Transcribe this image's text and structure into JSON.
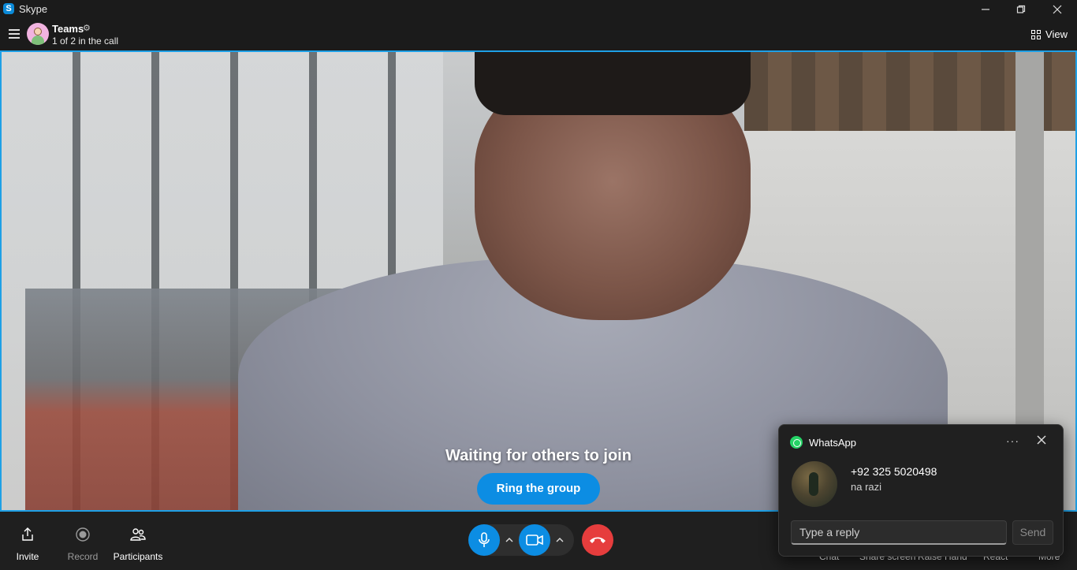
{
  "window": {
    "app_title": "Skype",
    "app_logo_letter": "S"
  },
  "header": {
    "conversation_title": "Teams",
    "subtitle": "1 of 2 in the call",
    "view_label": "View"
  },
  "call": {
    "status_text": "Waiting for others to join",
    "ring_button_label": "Ring the group"
  },
  "toolbar": {
    "invite_label": "Invite",
    "record_label": "Record",
    "participants_label": "Participants",
    "right_items": [
      "Chat",
      "Share screen",
      "Raise Hand",
      "React",
      "More"
    ]
  },
  "notification": {
    "app_name": "WhatsApp",
    "more_label": "···",
    "sender": "+92 325 5020498",
    "message": "na razi",
    "reply_placeholder": "Type a reply",
    "send_label": "Send"
  },
  "colors": {
    "accent": "#0c8de3",
    "hangup": "#e63d3d",
    "whatsapp": "#25d366",
    "video_border": "#1ea0e6"
  }
}
